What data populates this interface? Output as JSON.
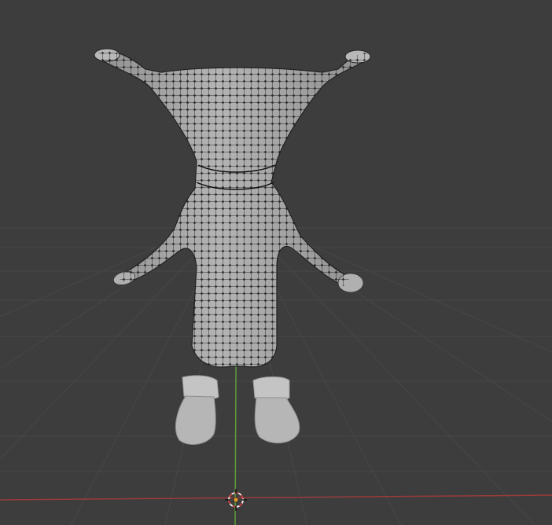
{
  "viewport": {
    "mode": "edit-mode-3d-viewport",
    "colors": {
      "background": "#3d3d3d",
      "grid_line": "#474747",
      "x_axis": "#9a3b3b",
      "y_axis": "#5e9b3a",
      "mesh_fill": "#a9a9a9",
      "mesh_shade": "#8c8c8c",
      "vertex": "#000000",
      "cursor_orange": "#e39a2a",
      "cursor_white": "#e8e8e8"
    },
    "icons": [
      "3d-cursor-icon"
    ]
  }
}
